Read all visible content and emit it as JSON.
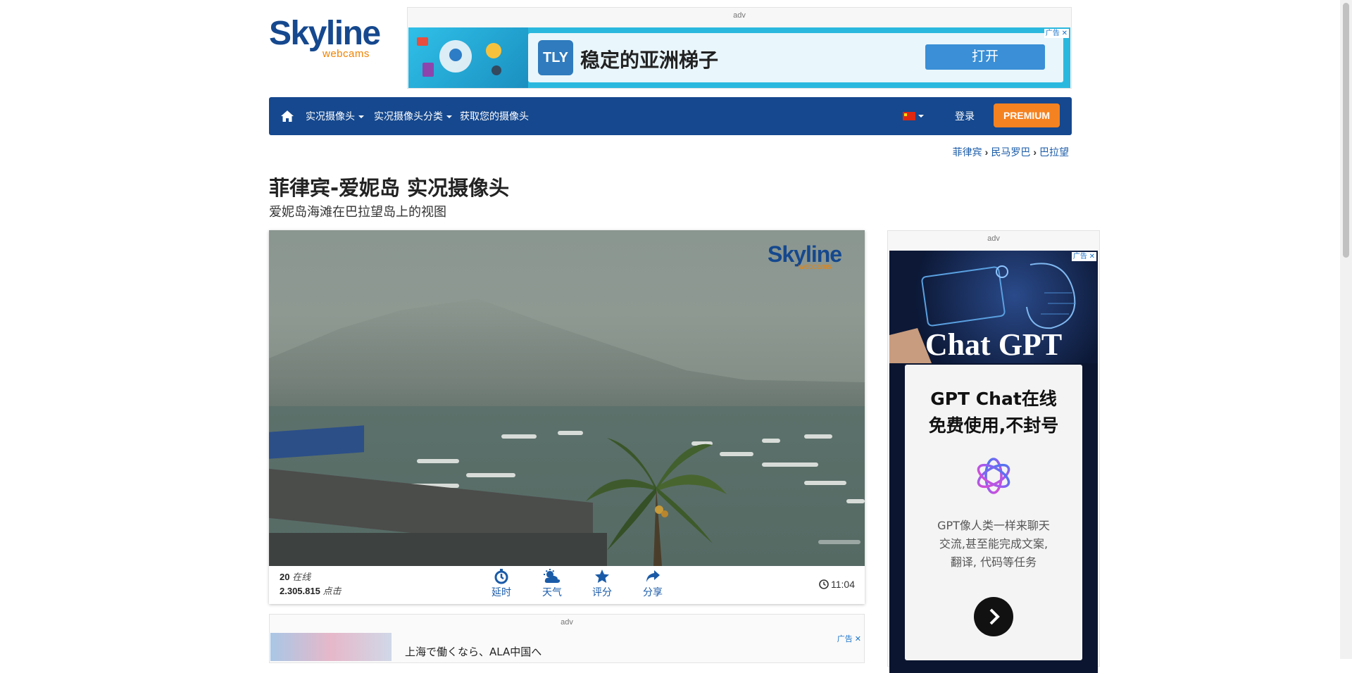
{
  "logo": {
    "main": "Skyline",
    "sub": "webcams"
  },
  "top_ad": {
    "label": "adv",
    "brand": "TLY",
    "headline": "稳定的亚洲梯子",
    "button": "打开",
    "adchoice": "广告"
  },
  "nav": {
    "items": [
      {
        "label": "实况摄像头"
      },
      {
        "label": "实况摄像头分类"
      },
      {
        "label": "获取您的摄像头"
      }
    ],
    "login": "登录",
    "premium": "PREMIUM"
  },
  "breadcrumb": [
    "菲律宾",
    "民马罗巴",
    "巴拉望"
  ],
  "page": {
    "title": "菲律宾-爱妮岛 实况摄像头",
    "subtitle": "爱妮岛海滩在巴拉望岛上的视图"
  },
  "player": {
    "watermark_main": "Skyline",
    "watermark_sub": "webcams",
    "online_count": "20",
    "online_label": "在线",
    "clicks_count": "2.305.815",
    "clicks_label": "点击",
    "buttons": [
      "延时",
      "天气",
      "评分",
      "分享"
    ],
    "time": "11:04"
  },
  "bottom_ad": {
    "label": "adv",
    "text": "上海で働くなら、ALA中国へ",
    "adchoice": "广告"
  },
  "side_ad": {
    "label": "adv",
    "hero": "Chat GPT",
    "headline_line1": "GPT Chat在线",
    "headline_line2": "免费使用,不封号",
    "desc_line1": "GPT像人类一样来聊天",
    "desc_line2": "交流,甚至能完成文案,",
    "desc_line3": "翻译, 代码等任务",
    "adchoice": "广告"
  },
  "colors": {
    "brand_blue": "#15488e",
    "brand_orange": "#f58220",
    "link": "#1a5ba8"
  }
}
